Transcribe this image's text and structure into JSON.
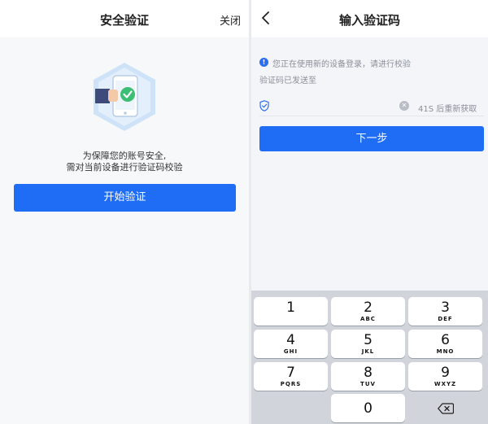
{
  "left": {
    "title": "安全验证",
    "close_label": "关闭",
    "notice_line1": "为保障您的账号安全,",
    "notice_line2": "需对当前设备进行验证码校验",
    "start_button": "开始验证"
  },
  "right": {
    "title": "输入验证码",
    "info_text": "您正在使用新的设备登录，请进行校验",
    "sent_text": "验证码已发送至",
    "resend_text": "41S 后重新获取",
    "next_button": "下一步"
  },
  "keypad": {
    "keys": [
      {
        "num": "1",
        "sub": ""
      },
      {
        "num": "2",
        "sub": "ABC"
      },
      {
        "num": "3",
        "sub": "DEF"
      },
      {
        "num": "4",
        "sub": "GHI"
      },
      {
        "num": "5",
        "sub": "JKL"
      },
      {
        "num": "6",
        "sub": "MNO"
      },
      {
        "num": "7",
        "sub": "PQRS"
      },
      {
        "num": "8",
        "sub": "TUV"
      },
      {
        "num": "9",
        "sub": "WXYZ"
      },
      {
        "num": "0",
        "sub": ""
      }
    ]
  },
  "colors": {
    "primary": "#1f6cf5",
    "shield": "#2a6ef3",
    "check": "#3cbf74"
  }
}
